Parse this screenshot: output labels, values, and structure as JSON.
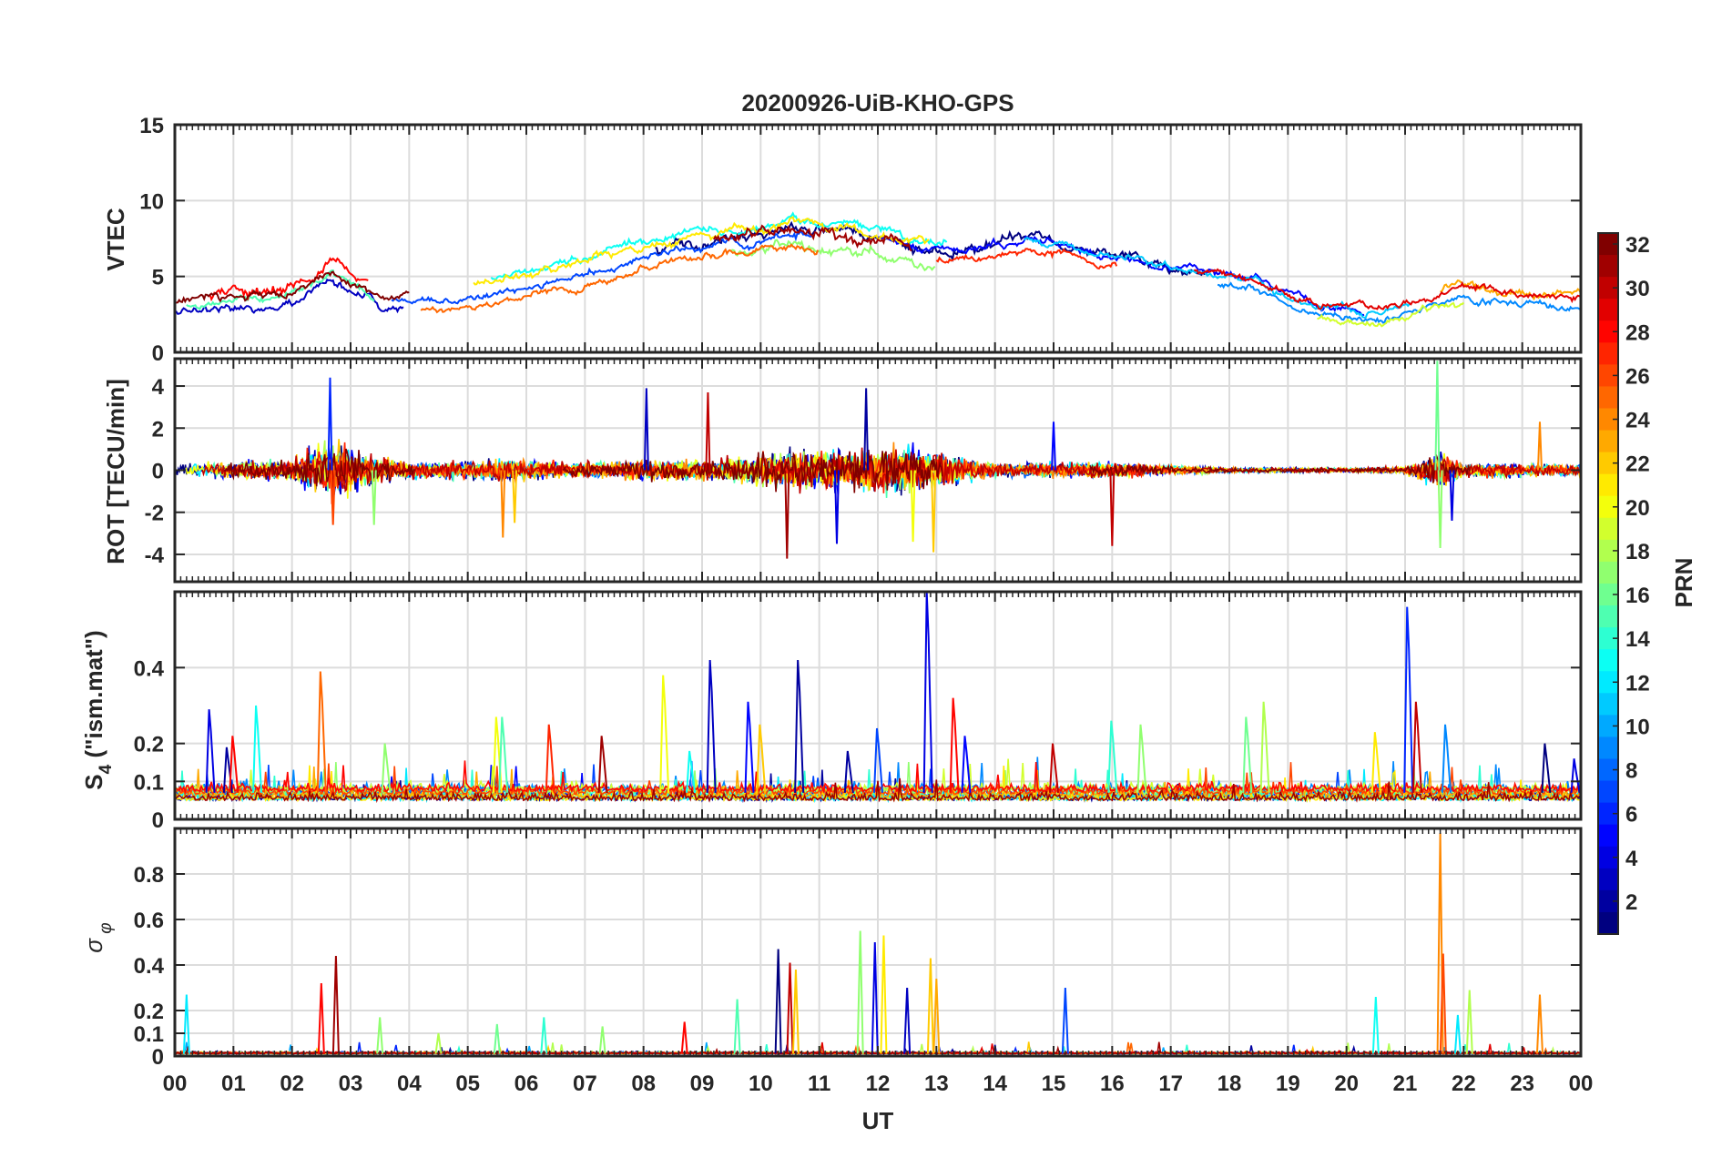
{
  "chart_data": {
    "type": "line",
    "title": "20200926-UiB-KHO-GPS",
    "xlabel": "UT",
    "x_range": [
      0,
      24
    ],
    "x_ticks": [
      "00",
      "01",
      "02",
      "03",
      "04",
      "05",
      "06",
      "07",
      "08",
      "09",
      "10",
      "11",
      "12",
      "13",
      "14",
      "15",
      "16",
      "17",
      "18",
      "19",
      "20",
      "21",
      "22",
      "23",
      "00"
    ],
    "grid": true,
    "colormap": "jet",
    "colorbar": {
      "label": "PRN",
      "range": [
        1,
        32
      ],
      "ticks": [
        2,
        4,
        6,
        8,
        10,
        12,
        14,
        16,
        18,
        20,
        22,
        24,
        26,
        28,
        30,
        32
      ],
      "tick_labels": [
        "2",
        "4",
        "6",
        "8",
        "10",
        "12",
        "14",
        "16",
        "18",
        "20",
        "22",
        "24",
        "26",
        "28",
        "30",
        "32"
      ],
      "placement": "right"
    },
    "panels": [
      {
        "id": "vtec",
        "ylabel": "VTEC",
        "ylim": [
          0,
          15
        ],
        "yticks": [
          0,
          5,
          10,
          15
        ],
        "ytick_labels": [
          "0",
          "5",
          "10",
          "15"
        ],
        "profile_x": [
          0,
          1,
          2,
          2.7,
          3.5,
          4.5,
          5.5,
          7,
          8,
          9,
          10,
          10.5,
          11.5,
          12.5,
          13.5,
          14.5,
          15.5,
          16.5,
          17.5,
          18.5,
          19.5,
          20.5,
          21.5,
          22,
          23,
          24
        ],
        "profile_y": [
          3.3,
          3.5,
          4,
          5.5,
          3.7,
          3.6,
          4.2,
          5.3,
          6.5,
          7.2,
          7.6,
          7.9,
          7.6,
          6.8,
          6.5,
          7.2,
          6.4,
          5.8,
          5.1,
          4.4,
          2.9,
          2.5,
          3.5,
          3.9,
          3.6,
          3.4
        ],
        "series": [
          {
            "prn": 1,
            "start": 8.2,
            "end": 17.6,
            "noise": 0.5,
            "offset": 0.2
          },
          {
            "prn": 3,
            "start": 0.0,
            "end": 3.9,
            "noise": 0.35,
            "offset": -0.6
          },
          {
            "prn": 5,
            "start": 12.0,
            "end": 20.3,
            "noise": 0.35,
            "offset": 0.3
          },
          {
            "prn": 7,
            "start": 3.7,
            "end": 10.9,
            "noise": 0.3,
            "offset": -0.3
          },
          {
            "prn": 9,
            "start": 17.8,
            "end": 24.0,
            "noise": 0.3,
            "offset": -0.4
          },
          {
            "prn": 11,
            "start": 14.5,
            "end": 21.1,
            "noise": 0.3,
            "offset": 0.1
          },
          {
            "prn": 13,
            "start": 5.4,
            "end": 13.2,
            "noise": 0.35,
            "offset": 0.7
          },
          {
            "prn": 15,
            "start": 0.2,
            "end": 3.4,
            "noise": 0.3,
            "offset": -0.3
          },
          {
            "prn": 17,
            "start": 9.5,
            "end": 13.0,
            "noise": 0.45,
            "offset": -0.8
          },
          {
            "prn": 19,
            "start": 19.5,
            "end": 22.0,
            "noise": 0.3,
            "offset": -0.6
          },
          {
            "prn": 21,
            "start": 5.1,
            "end": 12.9,
            "noise": 0.4,
            "offset": 0.5
          },
          {
            "prn": 23,
            "start": 21.6,
            "end": 24.0,
            "noise": 0.4,
            "offset": 0.3
          },
          {
            "prn": 25,
            "start": 4.2,
            "end": 11.0,
            "noise": 0.3,
            "offset": -0.9
          },
          {
            "prn": 27,
            "start": 13.0,
            "end": 16.1,
            "noise": 0.3,
            "offset": -0.5
          },
          {
            "prn": 28,
            "start": 0.6,
            "end": 3.3,
            "noise": 0.55,
            "offset": 0.4
          },
          {
            "prn": 29,
            "start": 17.4,
            "end": 24.0,
            "noise": 0.3,
            "offset": 0.2
          },
          {
            "prn": 31,
            "start": 9.2,
            "end": 12.6,
            "noise": 0.55,
            "offset": 0.0
          },
          {
            "prn": 32,
            "start": 0.0,
            "end": 4.0,
            "noise": 0.35,
            "offset": 0.1
          }
        ]
      },
      {
        "id": "rot",
        "ylabel": "ROT [TECU/min]",
        "ylim": [
          -5.3,
          5.3
        ],
        "yticks": [
          -4,
          -2,
          0,
          2,
          4
        ],
        "ytick_labels": [
          "-4",
          "-2",
          "0",
          "2",
          "4"
        ],
        "activity_x": [
          0,
          1,
          2,
          2.5,
          2.8,
          3.3,
          4,
          5,
          5.6,
          6.5,
          8,
          9,
          10,
          10.6,
          11.5,
          12.4,
          13,
          14,
          15,
          16,
          17,
          18,
          19,
          20,
          21,
          21.6,
          22,
          23,
          24
        ],
        "activity_y": [
          0.4,
          0.35,
          0.5,
          1.1,
          1.3,
          0.7,
          0.35,
          0.4,
          0.55,
          0.35,
          0.45,
          0.45,
          0.7,
          1.0,
          0.9,
          1.1,
          0.8,
          0.3,
          0.35,
          0.35,
          0.2,
          0.12,
          0.1,
          0.1,
          0.15,
          0.8,
          0.3,
          0.3,
          0.25
        ],
        "spikes": [
          [
            2.65,
            4.4
          ],
          [
            2.7,
            -2.6
          ],
          [
            3.4,
            -2.6
          ],
          [
            5.6,
            -3.2
          ],
          [
            5.8,
            -2.5
          ],
          [
            8.05,
            3.9
          ],
          [
            9.1,
            3.7
          ],
          [
            10.45,
            -4.2
          ],
          [
            11.3,
            -3.5
          ],
          [
            11.8,
            3.9
          ],
          [
            12.6,
            -3.4
          ],
          [
            12.95,
            -3.9
          ],
          [
            15.0,
            2.3
          ],
          [
            16.0,
            -3.6
          ],
          [
            21.55,
            5.2
          ],
          [
            21.6,
            -3.7
          ],
          [
            21.8,
            -2.4
          ],
          [
            23.3,
            2.3
          ]
        ]
      },
      {
        "id": "s4",
        "ylabel": "S4 (\"ism.mat\")",
        "ylim": [
          0,
          0.6
        ],
        "yticks": [
          0,
          0.1,
          0.2,
          0.4
        ],
        "ytick_labels": [
          "0",
          "0.1",
          "0.2",
          "0.4"
        ],
        "baseline": 0.07,
        "spikes": [
          [
            0.6,
            0.29
          ],
          [
            0.9,
            0.19
          ],
          [
            1.0,
            0.22
          ],
          [
            1.4,
            0.3
          ],
          [
            2.5,
            0.39
          ],
          [
            3.6,
            0.2
          ],
          [
            5.5,
            0.27
          ],
          [
            5.6,
            0.27
          ],
          [
            6.4,
            0.25
          ],
          [
            7.3,
            0.22
          ],
          [
            8.35,
            0.38
          ],
          [
            8.8,
            0.18
          ],
          [
            9.15,
            0.42
          ],
          [
            9.8,
            0.31
          ],
          [
            10.0,
            0.25
          ],
          [
            10.65,
            0.42
          ],
          [
            11.5,
            0.18
          ],
          [
            12.0,
            0.24
          ],
          [
            12.85,
            0.6
          ],
          [
            13.3,
            0.32
          ],
          [
            13.5,
            0.22
          ],
          [
            15.0,
            0.2
          ],
          [
            16.0,
            0.26
          ],
          [
            16.5,
            0.25
          ],
          [
            18.3,
            0.27
          ],
          [
            18.6,
            0.31
          ],
          [
            20.5,
            0.23
          ],
          [
            21.05,
            0.56
          ],
          [
            21.2,
            0.31
          ],
          [
            21.7,
            0.25
          ],
          [
            23.4,
            0.2
          ],
          [
            23.9,
            0.16
          ]
        ]
      },
      {
        "id": "sigma_phi",
        "ylabel": "σφ",
        "ylim": [
          0,
          1
        ],
        "yticks": [
          0,
          0.1,
          0.2,
          0.4,
          0.6,
          0.8
        ],
        "ytick_labels": [
          "0",
          "0.1",
          "0.2",
          "0.4",
          "0.6",
          "0.8"
        ],
        "baseline": 0.02,
        "spikes": [
          [
            0.2,
            0.27
          ],
          [
            2.5,
            0.32
          ],
          [
            2.75,
            0.44
          ],
          [
            3.5,
            0.17
          ],
          [
            4.5,
            0.1
          ],
          [
            5.5,
            0.14
          ],
          [
            6.3,
            0.17
          ],
          [
            7.3,
            0.13
          ],
          [
            8.7,
            0.15
          ],
          [
            9.6,
            0.25
          ],
          [
            10.3,
            0.47
          ],
          [
            10.5,
            0.41
          ],
          [
            10.6,
            0.38
          ],
          [
            11.7,
            0.55
          ],
          [
            11.95,
            0.5
          ],
          [
            12.1,
            0.53
          ],
          [
            12.5,
            0.3
          ],
          [
            12.9,
            0.43
          ],
          [
            13.0,
            0.34
          ],
          [
            15.2,
            0.3
          ],
          [
            20.5,
            0.26
          ],
          [
            21.6,
            0.98
          ],
          [
            21.65,
            0.45
          ],
          [
            21.9,
            0.18
          ],
          [
            22.1,
            0.29
          ],
          [
            23.3,
            0.27
          ]
        ]
      }
    ]
  }
}
